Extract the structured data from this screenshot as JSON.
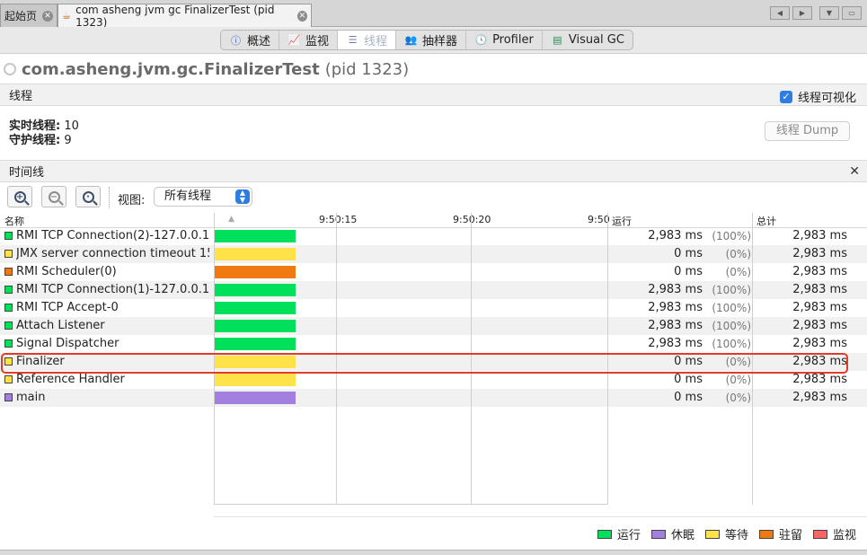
{
  "tabs": [
    {
      "label": "起始页"
    },
    {
      "label": "com asheng jvm gc FinalizerTest (pid 1323)"
    }
  ],
  "toolbar": {
    "views": [
      "概述",
      "监视",
      "线程",
      "抽样器",
      "Profiler",
      "Visual GC"
    ],
    "selected": "线程"
  },
  "process": {
    "name": "com.asheng.jvm.gc.FinalizerTest",
    "pid": "(pid 1323)"
  },
  "threads_section": {
    "title": "线程",
    "visualize_label": "线程可视化",
    "visualize_checked": true,
    "live_label": "实时线程:",
    "live_value": "10",
    "daemon_label": "守护线程:",
    "daemon_value": "9",
    "dump_label": "线程 Dump"
  },
  "timeline": {
    "title": "时间线",
    "view_label": "视图:",
    "view_value": "所有线程",
    "columns": {
      "name": "名称",
      "t1": "9:50:15",
      "t2": "9:50:20",
      "t3": "9:50",
      "running": "运行",
      "total": "总计"
    }
  },
  "colors": {
    "running": "#00e05a",
    "sleeping": "#a37fe0",
    "wait": "#ffe14a",
    "park": "#f07a12",
    "monitor": "#ff6464"
  },
  "threads": [
    {
      "name": "RMI TCP Connection(2)-127.0.0.1",
      "state": "running",
      "ms": "2,983 ms",
      "pct": "(100%)",
      "total": "2,983 ms"
    },
    {
      "name": "JMX server connection timeout 15",
      "state": "wait",
      "ms": "0 ms",
      "pct": "(0%)",
      "total": "2,983 ms"
    },
    {
      "name": "RMI Scheduler(0)",
      "state": "park",
      "ms": "0 ms",
      "pct": "(0%)",
      "total": "2,983 ms"
    },
    {
      "name": "RMI TCP Connection(1)-127.0.0.1",
      "state": "running",
      "ms": "2,983 ms",
      "pct": "(100%)",
      "total": "2,983 ms"
    },
    {
      "name": "RMI TCP Accept-0",
      "state": "running",
      "ms": "2,983 ms",
      "pct": "(100%)",
      "total": "2,983 ms"
    },
    {
      "name": "Attach Listener",
      "state": "running",
      "ms": "2,983 ms",
      "pct": "(100%)",
      "total": "2,983 ms"
    },
    {
      "name": "Signal Dispatcher",
      "state": "running",
      "ms": "2,983 ms",
      "pct": "(100%)",
      "total": "2,983 ms"
    },
    {
      "name": "Finalizer",
      "state": "wait",
      "ms": "0 ms",
      "pct": "(0%)",
      "total": "2,983 ms"
    },
    {
      "name": "Reference Handler",
      "state": "wait",
      "ms": "0 ms",
      "pct": "(0%)",
      "total": "2,983 ms"
    },
    {
      "name": "main",
      "state": "sleeping",
      "ms": "0 ms",
      "pct": "(0%)",
      "total": "2,983 ms"
    }
  ],
  "legend": [
    {
      "key": "running",
      "label": "运行"
    },
    {
      "key": "sleeping",
      "label": "休眠"
    },
    {
      "key": "wait",
      "label": "等待"
    },
    {
      "key": "park",
      "label": "驻留"
    },
    {
      "key": "monitor",
      "label": "监视"
    }
  ]
}
